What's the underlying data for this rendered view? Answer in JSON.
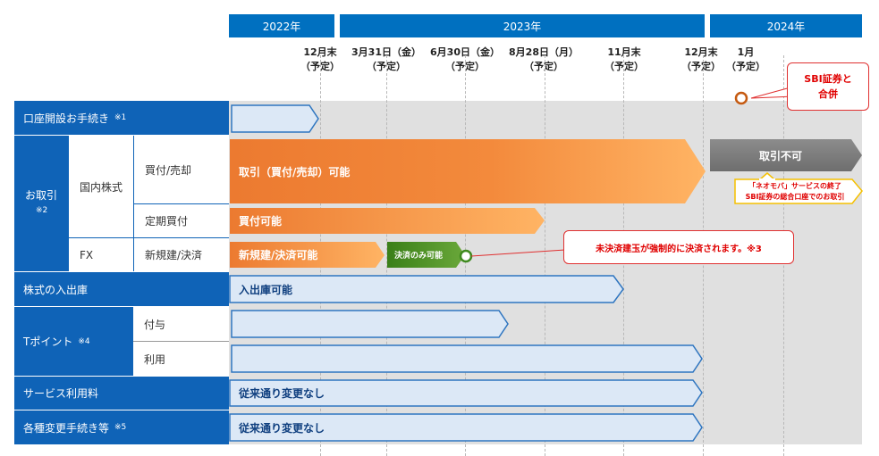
{
  "years": [
    {
      "label": "2022年"
    },
    {
      "label": "2023年"
    },
    {
      "label": "2024年"
    }
  ],
  "dates": [
    {
      "l1": "12月末",
      "l2": "（予定）"
    },
    {
      "l1": "3月31日（金）",
      "l2": "（予定）"
    },
    {
      "l1": "6月30日（金）",
      "l2": "（予定）"
    },
    {
      "l1": "8月28日（月）",
      "l2": "（予定）"
    },
    {
      "l1": "11月末",
      "l2": "（予定）"
    },
    {
      "l1": "12月末",
      "l2": "（予定）"
    },
    {
      "l1": "1月",
      "l2": "（予定）"
    }
  ],
  "rows": {
    "account": {
      "label": "口座開設お手続き",
      "note": "※1"
    },
    "trading": {
      "label": "お取引",
      "note": "※2"
    },
    "domestic": {
      "label": "国内株式"
    },
    "buy_sell": {
      "label": "買付/売却"
    },
    "periodic": {
      "label": "定期買付"
    },
    "fx": {
      "label": "FX"
    },
    "fx_sub": {
      "label": "新規建/決済"
    },
    "transfer": {
      "label": "株式の入出庫"
    },
    "tpoint": {
      "label": "Tポイント",
      "note": "※4"
    },
    "grant": {
      "label": "付与"
    },
    "use": {
      "label": "利用"
    },
    "fee": {
      "label": "サービス利用料"
    },
    "changes": {
      "label": "各種変更手続き等",
      "note": "※5"
    }
  },
  "bars": {
    "trade_possible": "取引（買付/売却）可能",
    "trade_impossible": "取引不可",
    "buy_possible": "買付可能",
    "fx_new": "新規建/決済可能",
    "fx_settle_only": "決済のみ可能",
    "transfer_possible": "入出庫可能",
    "fee_nochange": "従来通り変更なし",
    "changes_nochange": "従来通り変更なし"
  },
  "callouts": {
    "merge_l1": "SBI証券と",
    "merge_l2": "合併",
    "fx_forced": "未決済建玉が強制的に決済されます。※3",
    "end_l1": "「ネオモバ」サービスの終了",
    "end_l2": "SBI証券の総合口座でのお取引"
  },
  "colors": {
    "header_blue": "#0f63b7",
    "year_blue": "#0070c0",
    "orange": "#ee7d32",
    "light_orange": "#ffb060",
    "gray_bar": "#7f7f7f",
    "green": "#3f8a1e",
    "light_blue": "#dce8f6",
    "red": "#e00000"
  }
}
